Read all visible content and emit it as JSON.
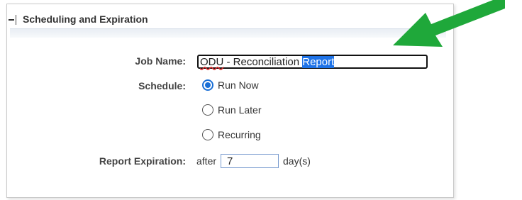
{
  "section": {
    "title": "Scheduling and Expiration"
  },
  "form": {
    "job_name_label": "Job Name:",
    "job_name_prefix": "ODU",
    "job_name_middle": " - Reconciliation ",
    "job_name_selected": "Report",
    "schedule_label": "Schedule:",
    "schedule_options": [
      {
        "label": "Run Now",
        "checked": true
      },
      {
        "label": "Run Later",
        "checked": false
      },
      {
        "label": "Recurring",
        "checked": false
      }
    ],
    "expiration_label": "Report Expiration:",
    "expiration_prefix": "after",
    "expiration_value": "7",
    "expiration_suffix": "day(s)"
  },
  "colors": {
    "annotation_arrow": "#1fa83a",
    "selection": "#1e73e8",
    "radio_accent": "#1a6fd6"
  },
  "icons": {
    "collapse": "collapse-minus-icon",
    "annotation": "green-arrow-icon"
  }
}
